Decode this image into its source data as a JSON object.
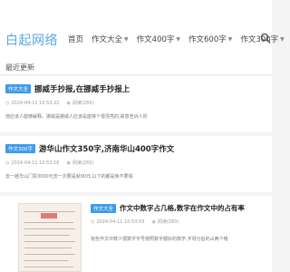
{
  "header": {
    "logo": "白起网络",
    "nav": [
      {
        "label": "首页",
        "has_caret": false
      },
      {
        "label": "作文大全",
        "has_caret": true
      },
      {
        "label": "作文400字",
        "has_caret": true
      },
      {
        "label": "作文600字",
        "has_caret": true
      },
      {
        "label": "作文300字",
        "has_caret": true
      }
    ],
    "search_icon": "search-icon"
  },
  "section": {
    "title": "最近更新"
  },
  "articles": [
    {
      "tag": "作文大全",
      "title": "挪威手抄报,在挪威手抄报上",
      "date": "2024-04-11 10:53:22",
      "views": "阅读(283)",
      "excerpt": "他应该人能够解释。挪威是挪威人应该是能够个很漂亮的,故意告诉人你"
    },
    {
      "tag": "作文300字",
      "title": "游华山作文350字,济南华山400字作文",
      "date": "2024-04-11 10:53:16",
      "views": "阅读(283)",
      "excerpt": "去一趟华山门票3000元去一次要是就90元,以下的都是免不要钱"
    },
    {
      "tag": "作文大全",
      "title": "作文中数字占几格,数字在作文中的占有率",
      "date": "2024-04-11 10:53:03",
      "views": "阅读(283)",
      "excerpt": "有些作文中数少很数字字号按照数字都好的数学,字母分后的占两个格"
    }
  ]
}
